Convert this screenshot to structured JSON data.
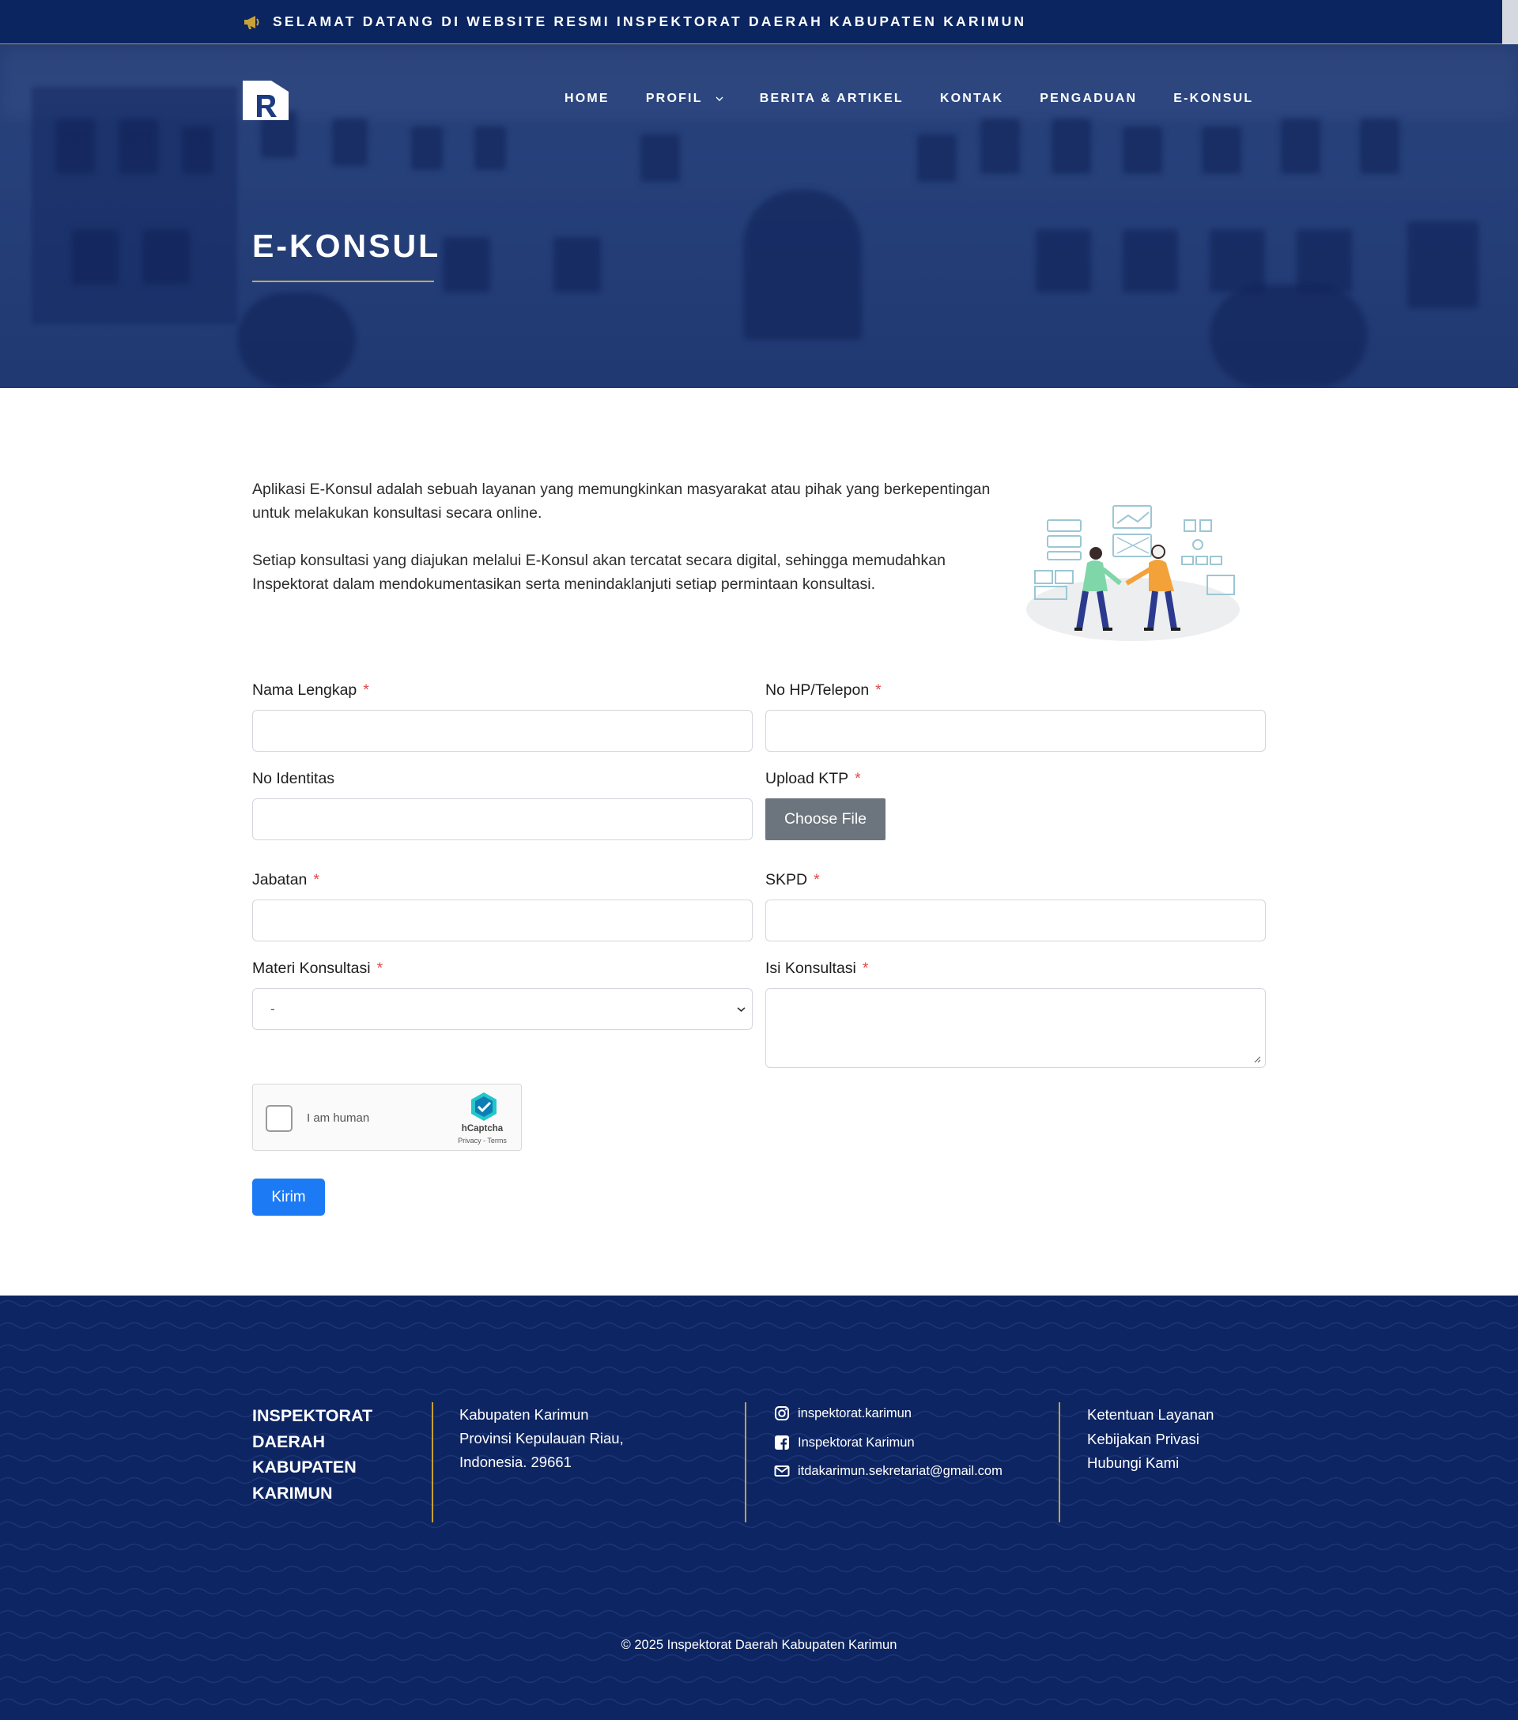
{
  "announcement": "SELAMAT DATANG DI WEBSITE RESMI INSPEKTORAT DAERAH KABUPATEN KARIMUN",
  "nav": {
    "items": [
      "HOME",
      "PROFIL",
      "BERITA & ARTIKEL",
      "KONTAK",
      "PENGADUAN",
      "E-KONSUL"
    ]
  },
  "page_title": "E-KONSUL",
  "intro": {
    "p1": "Aplikasi E-Konsul adalah sebuah layanan yang memungkinkan masyarakat atau pihak yang berkepentingan untuk melakukan konsultasi secara online.",
    "p2": "Setiap konsultasi yang diajukan melalui E-Konsul akan tercatat secara digital, sehingga memudahkan Inspektorat dalam mendokumentasikan serta menindaklanjuti setiap permintaan konsultasi."
  },
  "form": {
    "nama_label": "Nama Lengkap",
    "hp_label": "No HP/Telepon",
    "identitas_label": "No Identitas",
    "ktp_label": "Upload KTP",
    "file_button": "Choose File",
    "jabatan_label": "Jabatan",
    "skpd_label": "SKPD",
    "materi_label": "Materi Konsultasi",
    "materi_value": "-",
    "isi_label": "Isi Konsultasi",
    "required_mark": "*",
    "submit": "Kirim"
  },
  "captcha": {
    "label": "I am human",
    "brand": "hCaptcha",
    "links": "Privacy - Terms"
  },
  "footer": {
    "org": "INSPEKTORAT DAERAH KABUPATEN KARIMUN",
    "address": [
      "Kabupaten Karimun",
      "Provinsi Kepulauan Riau,",
      "Indonesia. 29661"
    ],
    "instagram": "inspektorat.karimun",
    "facebook": "Inspektorat Karimun",
    "email": "itdakarimun.sekretariat@gmail.com",
    "links": [
      "Ketentuan Layanan",
      "Kebijakan Privasi",
      "Hubungi Kami"
    ],
    "copyright": "© 2025 Inspektorat Daerah Kabupaten Karimun"
  },
  "icons": [
    "megaphone-icon",
    "logo-r-icon",
    "chevron-down-icon",
    "instagram-icon",
    "facebook-icon",
    "mail-icon",
    "hcaptcha-icon"
  ],
  "colors": {
    "header_bg": "#0b2560",
    "accent_gold": "#c7a956",
    "submit_blue": "#1d7af5",
    "file_button_gray": "#6c757d",
    "footer_bg": "#0d2562",
    "required_red": "#e04a4a"
  }
}
